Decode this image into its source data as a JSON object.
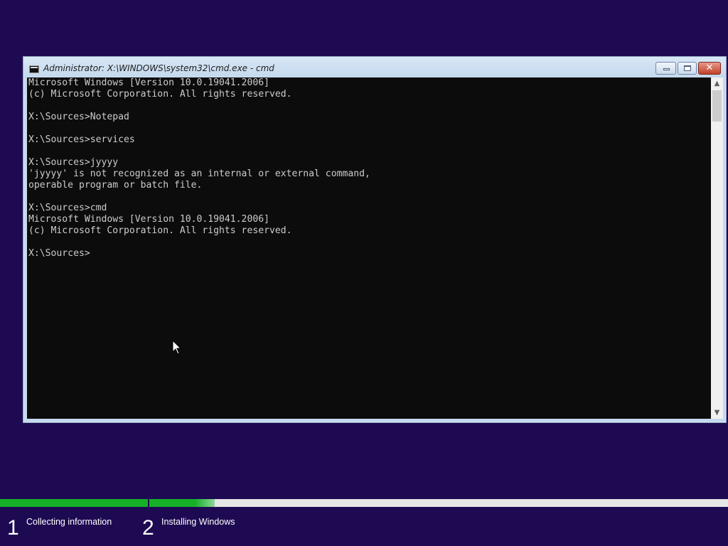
{
  "window": {
    "title": "Administrator: X:\\WINDOWS\\system32\\cmd.exe - cmd",
    "minimize_label": "",
    "close_glyph": "✕"
  },
  "console": {
    "lines": [
      "Microsoft Windows [Version 10.0.19041.2006]",
      "(c) Microsoft Corporation. All rights reserved.",
      "",
      "X:\\Sources>Notepad",
      "",
      "X:\\Sources>services",
      "",
      "X:\\Sources>jyyyy",
      "'jyyyy' is not recognized as an internal or external command,",
      "operable program or batch file.",
      "",
      "X:\\Sources>cmd",
      "Microsoft Windows [Version 10.0.19041.2006]",
      "(c) Microsoft Corporation. All rights reserved.",
      "",
      "X:\\Sources>"
    ]
  },
  "scrollbar": {
    "up_glyph": "▲",
    "down_glyph": "▼"
  },
  "setup": {
    "steps": [
      {
        "number": "1",
        "label": "Collecting information",
        "progress": 1.0
      },
      {
        "number": "2",
        "label": "Installing Windows",
        "progress": 0.32
      }
    ],
    "accent_color": "#16b129",
    "background_color": "#1e0a52"
  },
  "icons": {
    "title": "cmd-console-icon",
    "cursor": "mouse-pointer-icon"
  }
}
